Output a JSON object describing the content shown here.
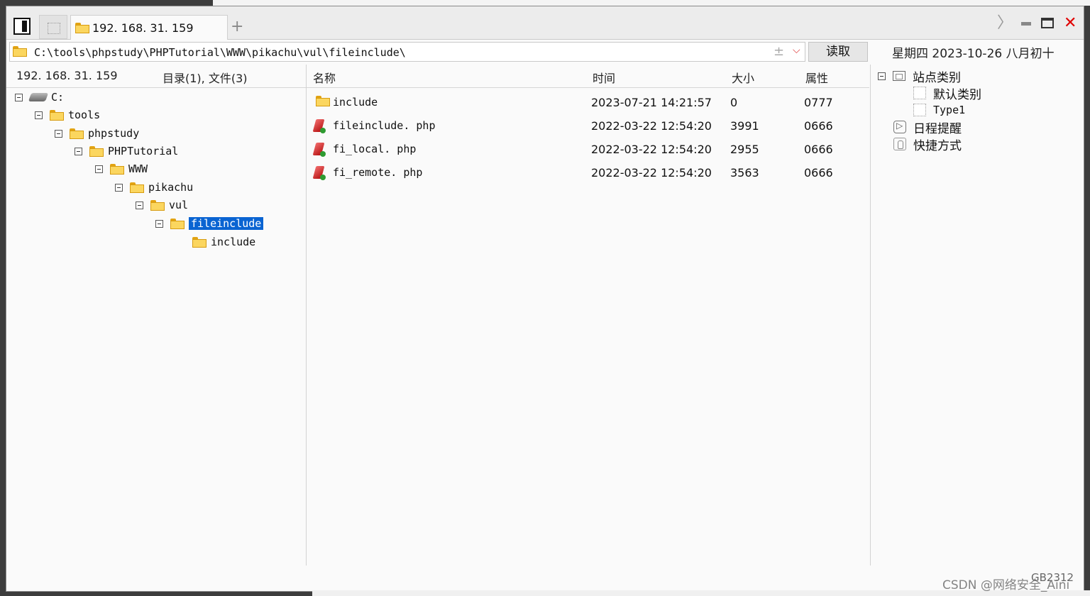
{
  "tab": {
    "label": "192. 168. 31. 159"
  },
  "address": {
    "path": "C:\\tools\\phpstudy\\PHPTutorial\\WWW\\pikachu\\vul\\fileinclude\\",
    "plus": "±",
    "dropdown": "⌵"
  },
  "read_button": "读取",
  "date_line": "星期四 2023-10-26 八月初十",
  "window_controls": {
    "next": "〉",
    "close": "✕"
  },
  "info": {
    "host": "192. 168. 31. 159",
    "counts": "目录(1), 文件(3)"
  },
  "columns": {
    "name": "名称",
    "time": "时间",
    "size": "大小",
    "attr": "属性"
  },
  "tree": {
    "nodes": [
      {
        "label": "C:",
        "icon": "drive-icon"
      },
      {
        "label": "tools",
        "icon": "folder-icon"
      },
      {
        "label": "phpstudy",
        "icon": "folder-icon"
      },
      {
        "label": "PHPTutorial",
        "icon": "folder-icon"
      },
      {
        "label": "WWW",
        "icon": "folder-icon"
      },
      {
        "label": "pikachu",
        "icon": "folder-icon"
      },
      {
        "label": "vul",
        "icon": "folder-icon"
      },
      {
        "label": "fileinclude",
        "icon": "folder-open-icon",
        "selected": true
      },
      {
        "label": "include",
        "icon": "folder-icon"
      }
    ]
  },
  "files": [
    {
      "name": "include",
      "time": "2023-07-21 14:21:57",
      "size": "0",
      "attr": "0777",
      "icon": "folder-icon"
    },
    {
      "name": "fileinclude. php",
      "time": "2022-03-22 12:54:20",
      "size": "3991",
      "attr": "0666",
      "icon": "php-file-icon"
    },
    {
      "name": "fi_local. php",
      "time": "2022-03-22 12:54:20",
      "size": "2955",
      "attr": "0666",
      "icon": "php-file-icon"
    },
    {
      "name": "fi_remote. php",
      "time": "2022-03-22 12:54:20",
      "size": "3563",
      "attr": "0666",
      "icon": "php-file-icon"
    }
  ],
  "side": {
    "site_category": "站点类别",
    "default_category": "默认类别",
    "type1": "Type1",
    "schedule": "日程提醒",
    "shortcuts": "快捷方式"
  },
  "code_label": "GB2312",
  "watermark": "CSDN @网络安全_Aini"
}
